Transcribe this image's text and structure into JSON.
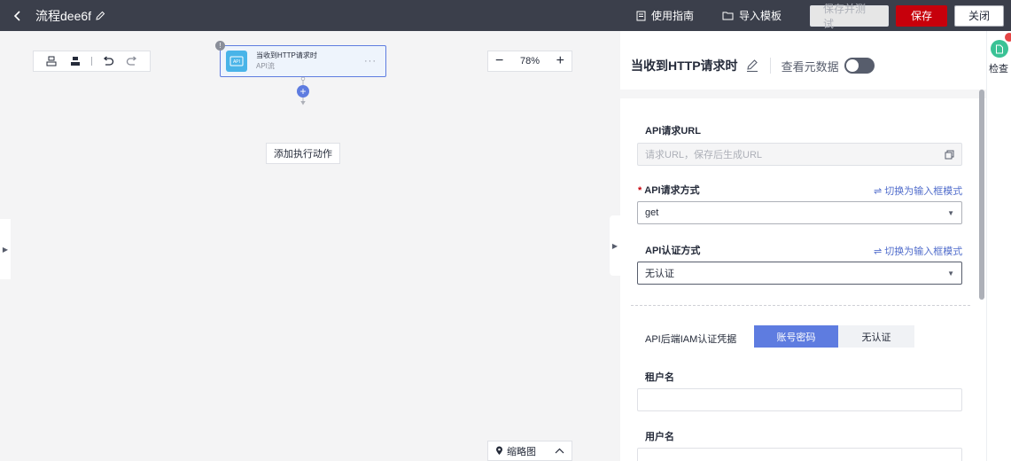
{
  "topbar": {
    "flow_title": "流程dee6f",
    "guide_label": "使用指南",
    "import_label": "导入模板",
    "save_test_label": "保存并测试",
    "save_label": "保存",
    "close_label": "关闭"
  },
  "canvas": {
    "zoom_level": "78%",
    "node_title": "当收到HTTP请求时",
    "node_subtitle": "API流",
    "add_action_label": "添加执行动作",
    "minimap_label": "缩略图"
  },
  "panel": {
    "title": "当收到HTTP请求时",
    "meta_label": "查看元数据",
    "meta_toggle_on": false,
    "url_label": "API请求URL",
    "url_placeholder": "请求URL，保存后生成URL",
    "method_label": "API请求方式",
    "method_required": "*",
    "method_value": "get",
    "switch_label_1": "切换为输入框模式",
    "auth_label": "API认证方式",
    "auth_value": "无认证",
    "switch_label_2": "切换为输入框模式",
    "iam_label": "API后端IAM认证凭据",
    "iam_option_on": "账号密码",
    "iam_option_off": "无认证",
    "tenant_label": "租户名",
    "user_label": "用户名"
  },
  "rail": {
    "check_label": "检查"
  },
  "colors": {
    "topbar_bg": "#3b3f4b",
    "save_red": "#c7000b",
    "accent_blue": "#5e7ce0",
    "link_blue": "#526ecc",
    "check_green": "#3ac295"
  }
}
